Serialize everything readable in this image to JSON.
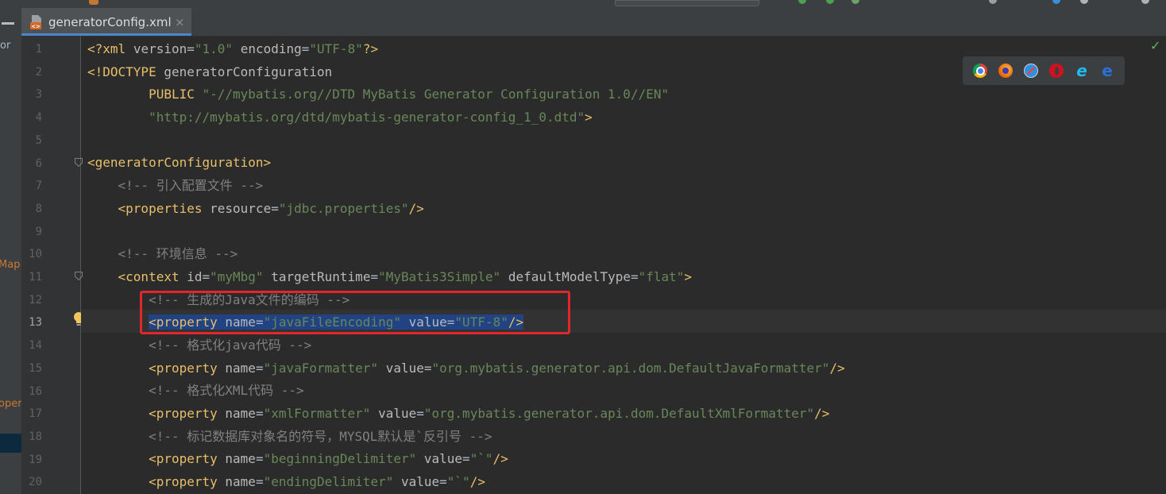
{
  "tab": {
    "title": "generatorConfig.xml",
    "close": "×",
    "icon": "xml-file-icon"
  },
  "left_panel": {
    "frag_or": "or",
    "frag_map": "Map",
    "frag_oper": "oper"
  },
  "status": {
    "check": "✓"
  },
  "browsers": [
    "chrome",
    "firefox",
    "safari",
    "opera",
    "internet-explorer",
    "edge"
  ],
  "line_numbers": [
    "1",
    "2",
    "3",
    "4",
    "5",
    "6",
    "7",
    "8",
    "9",
    "10",
    "11",
    "12",
    "13",
    "14",
    "15",
    "16",
    "17",
    "18",
    "19",
    "20"
  ],
  "code": {
    "l1": {
      "open": "<?",
      "tag": "xml",
      "attr1": "version",
      "val1": "\"1.0\"",
      "attr2": "encoding",
      "val2": "\"UTF-8\"",
      "close": "?>"
    },
    "l2": {
      "text": "<!DOCTYPE",
      "name": "generatorConfiguration"
    },
    "l3": {
      "kw": "PUBLIC",
      "val": "\"-//mybatis.org//DTD MyBatis Generator Configuration 1.0//EN\""
    },
    "l4": {
      "val": "\"http://mybatis.org/dtd/mybatis-generator-config_1_0.dtd\"",
      "close": ">"
    },
    "l6": {
      "tag": "<generatorConfiguration>"
    },
    "l7": {
      "comment": "<!-- 引入配置文件 -->"
    },
    "l8": {
      "open": "<properties",
      "attr": "resource",
      "val": "\"jdbc.properties\"",
      "close": "/>"
    },
    "l10": {
      "comment": "<!-- 环境信息 -->"
    },
    "l11": {
      "open": "<context",
      "attr1": "id",
      "val1": "\"myMbg\"",
      "attr2": "targetRuntime",
      "val2": "\"MyBatis3Simple\"",
      "attr3": "defaultModelType",
      "val3": "\"flat\"",
      "close": ">"
    },
    "l12": {
      "comment": "<!-- 生成的Java文件的编码 -->"
    },
    "l13": {
      "open": "<property",
      "attr1": "name",
      "val1": "\"javaFileEncoding\"",
      "attr2": "value",
      "val2": "\"UTF-8\"",
      "close": "/>"
    },
    "l14": {
      "comment": "<!-- 格式化java代码 -->"
    },
    "l15": {
      "open": "<property",
      "attr1": "name",
      "val1": "\"javaFormatter\"",
      "attr2": "value",
      "val2": "\"org.mybatis.generator.api.dom.DefaultJavaFormatter\"",
      "close": "/>"
    },
    "l16": {
      "comment": "<!-- 格式化XML代码 -->"
    },
    "l17": {
      "open": "<property",
      "attr1": "name",
      "val1": "\"xmlFormatter\"",
      "attr2": "value",
      "val2": "\"org.mybatis.generator.api.dom.DefaultXmlFormatter\"",
      "close": "/>"
    },
    "l18": {
      "comment": "<!-- 标记数据库对象名的符号，MYSQL默认是`反引号 -->"
    },
    "l19": {
      "open": "<property",
      "attr1": "name",
      "val1": "\"beginningDelimiter\"",
      "attr2": "value",
      "val2": "\"`\"",
      "close": "/>"
    },
    "l20": {
      "open": "<property",
      "attr1": "name",
      "val1": "\"endingDelimiter\"",
      "attr2": "value",
      "val2": "\"`\"",
      "close": "/>"
    }
  },
  "colors": {
    "background": "#2b2b2b",
    "gutter": "#313335",
    "tag": "#e8bf6a",
    "attr": "#bababa",
    "string": "#6a8759",
    "comment": "#808080",
    "selection": "#214283",
    "annotation_box": "#e0272d"
  }
}
